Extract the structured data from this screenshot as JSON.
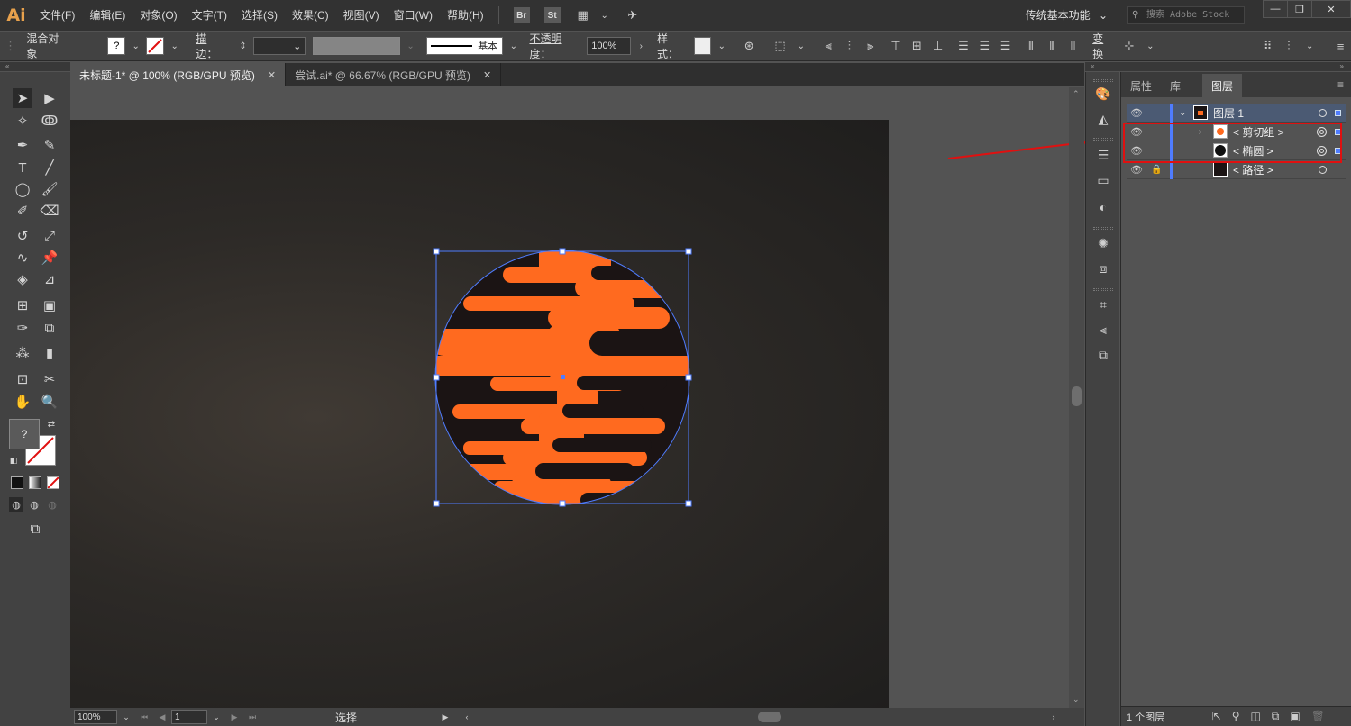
{
  "app": {
    "logo": "Ai"
  },
  "menu": [
    "文件(F)",
    "编辑(E)",
    "对象(O)",
    "文字(T)",
    "选择(S)",
    "效果(C)",
    "视图(V)",
    "窗口(W)",
    "帮助(H)"
  ],
  "bridge_icons": [
    "Br",
    "St"
  ],
  "workspace": {
    "label": "传统基本功能",
    "chevron": "⌄"
  },
  "search": {
    "placeholder": "搜索 Adobe Stock"
  },
  "window_buttons": {
    "minimize": "—",
    "restore": "❐",
    "close": "✕"
  },
  "controlbar": {
    "selection_type": "混合对象",
    "fill_value": "?",
    "stroke_label": "描边：",
    "stroke_profile": "基本",
    "opacity_label": "不透明度：",
    "opacity_value": "100%",
    "style_label": "样式：",
    "transform_label": "变换"
  },
  "tabs": [
    {
      "title": "未标题-1* @ 100% (RGB/GPU 预览)",
      "close": "✕"
    },
    {
      "title": "尝试.ai* @ 66.67% (RGB/GPU 预览)",
      "close": "✕"
    }
  ],
  "toolbar": {
    "fill_value": "?"
  },
  "statusbar": {
    "zoom": "100%",
    "page": "1",
    "tool": "选择"
  },
  "layers_panel": {
    "tabs": [
      "属性",
      "库",
      "图层"
    ],
    "active_tab": "图层",
    "menu_icon": "≡",
    "rows": [
      {
        "name": "图层  1",
        "level": 0,
        "expanded": true
      },
      {
        "name": "< 剪切组 >",
        "level": 1,
        "expanded": false
      },
      {
        "name": "< 椭圆 >",
        "level": 1
      },
      {
        "name": "< 路径 >",
        "level": 0,
        "locked": true
      }
    ],
    "footer": "1 个图层"
  },
  "colors": {
    "orange": "#ff6a1f",
    "dark": "#1b1414",
    "selection": "#4f7cff",
    "highlight_box": "#e01010",
    "arrow": "#e01010"
  }
}
